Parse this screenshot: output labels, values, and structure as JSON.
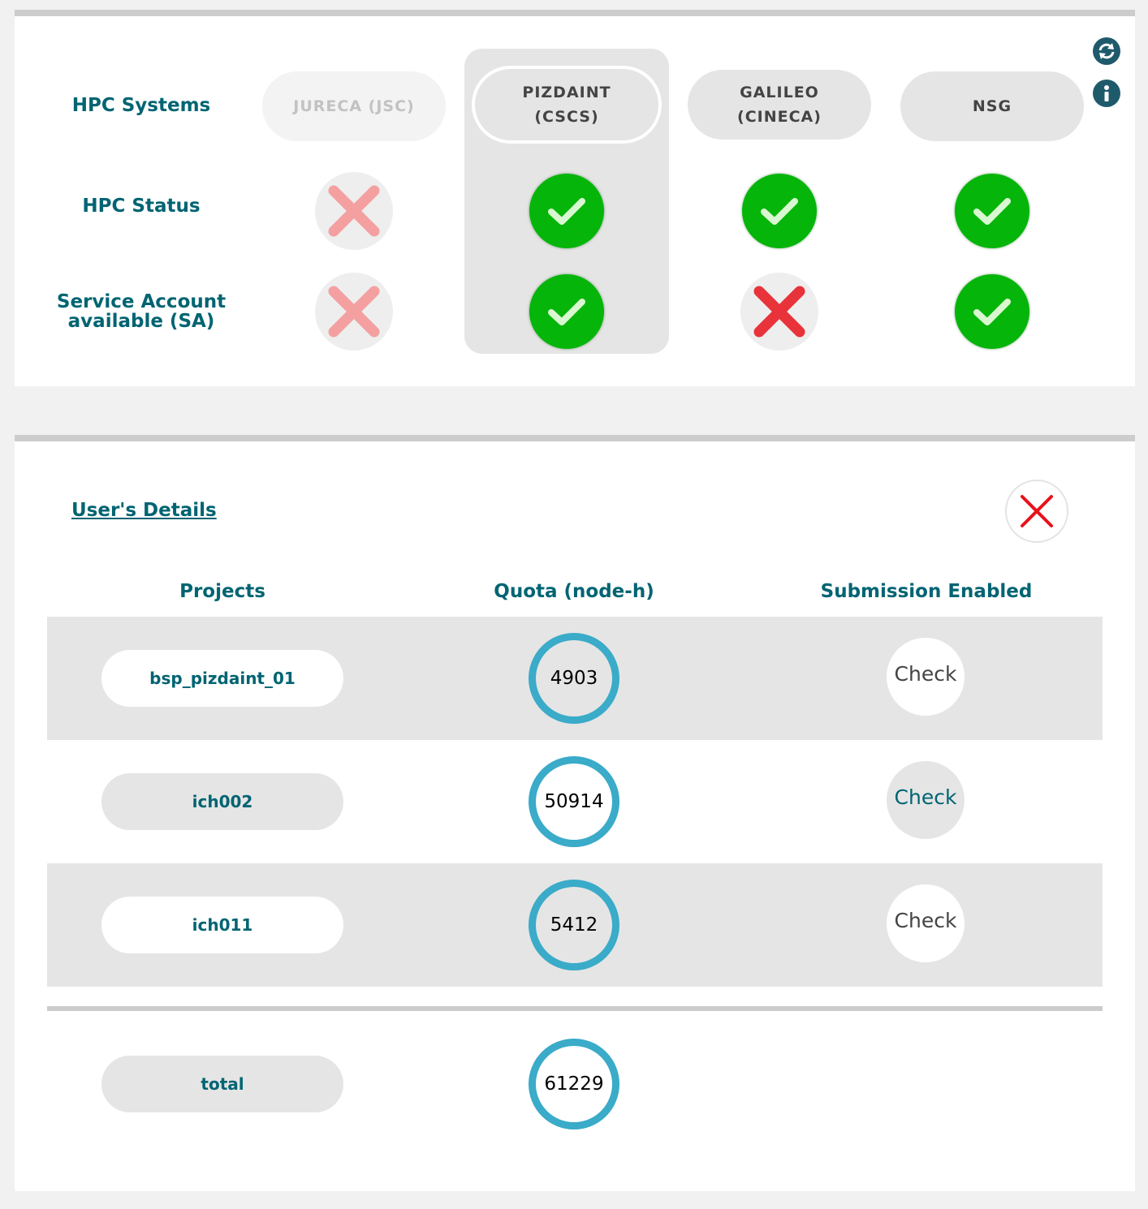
{
  "hpc": {
    "labels": {
      "systems": "HPC Systems",
      "status": "HPC Status",
      "service_account_line1": "Service Account",
      "service_account_line2": "available (SA)"
    },
    "systems": [
      {
        "name": "JURECA (JSC)",
        "state": "disabled",
        "status": "unavailable",
        "service_account": "unavailable"
      },
      {
        "name": "PIZDAINT\n(CSCS)",
        "state": "selected",
        "status": "ok",
        "service_account": "ok"
      },
      {
        "name": "GALILEO\n(CINECA)",
        "state": "normal",
        "status": "ok",
        "service_account": "missing"
      },
      {
        "name": "NSG",
        "state": "normal",
        "status": "ok",
        "service_account": "ok"
      }
    ],
    "side_icons": [
      "refresh-icon",
      "info-icon"
    ]
  },
  "user_details": {
    "title": "User's Details",
    "close_icon": "close-icon",
    "headers": {
      "projects": "Projects",
      "quota": "Quota (node-h)",
      "submission": "Submission Enabled"
    },
    "projects": [
      {
        "name": "bsp_pizdaint_01",
        "quota": "4903",
        "action": "Check"
      },
      {
        "name": "ich002",
        "quota": "50914",
        "action": "Check"
      },
      {
        "name": "ich011",
        "quota": "5412",
        "action": "Check"
      }
    ],
    "total": {
      "label": "total",
      "quota": "61229"
    }
  },
  "colors": {
    "accent_teal": "#006472",
    "ok_green": "#05b50a",
    "error_red": "#e8333a",
    "quota_ring": "#3aabc8"
  }
}
